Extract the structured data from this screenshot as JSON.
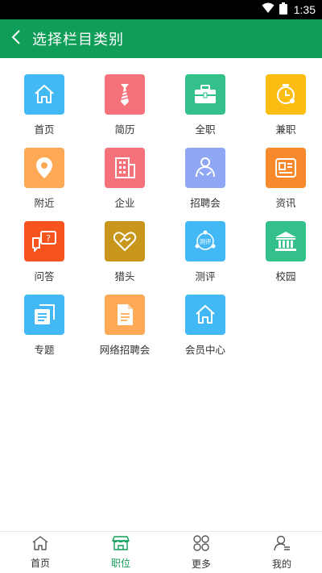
{
  "status": {
    "time": "1:35"
  },
  "header": {
    "title": "选择栏目类别"
  },
  "grid": {
    "items": [
      {
        "label": "首页",
        "icon": "home-icon",
        "color": "#42b9f5"
      },
      {
        "label": "简历",
        "icon": "tie-icon",
        "color": "#f5727a"
      },
      {
        "label": "全职",
        "icon": "briefcase-icon",
        "color": "#33c08a"
      },
      {
        "label": "兼职",
        "icon": "clock-icon",
        "color": "#fbbd12"
      },
      {
        "label": "附近",
        "icon": "location-pin-icon",
        "color": "#fea956"
      },
      {
        "label": "企业",
        "icon": "building-icon",
        "color": "#f5727a"
      },
      {
        "label": "招聘会",
        "icon": "handshake-people-icon",
        "color": "#8fa7f5"
      },
      {
        "label": "资讯",
        "icon": "news-icon",
        "color": "#f6892c"
      },
      {
        "label": "问答",
        "icon": "question-chat-icon",
        "color": "#f7531e"
      },
      {
        "label": "猎头",
        "icon": "heart-handshake-icon",
        "color": "#c8961a"
      },
      {
        "label": "测评",
        "icon": "evaluation-icon",
        "color": "#42b9f5"
      },
      {
        "label": "校园",
        "icon": "campus-building-icon",
        "color": "#33c08a"
      },
      {
        "label": "专题",
        "icon": "topic-cards-icon",
        "color": "#42b9f5"
      },
      {
        "label": "网络招聘会",
        "icon": "document-icon",
        "color": "#fea956"
      },
      {
        "label": "会员中心",
        "icon": "home-icon",
        "color": "#42b9f5"
      }
    ],
    "evaluation_icon_text": "测评"
  },
  "bottom_nav": {
    "items": [
      {
        "label": "首页",
        "icon": "home-outline-icon"
      },
      {
        "label": "职位",
        "icon": "job-store-icon"
      },
      {
        "label": "更多",
        "icon": "more-clover-icon"
      },
      {
        "label": "我的",
        "icon": "profile-icon"
      }
    ],
    "active_color": "#0f9d58"
  },
  "theme": {
    "primary": "#0f9d58"
  }
}
